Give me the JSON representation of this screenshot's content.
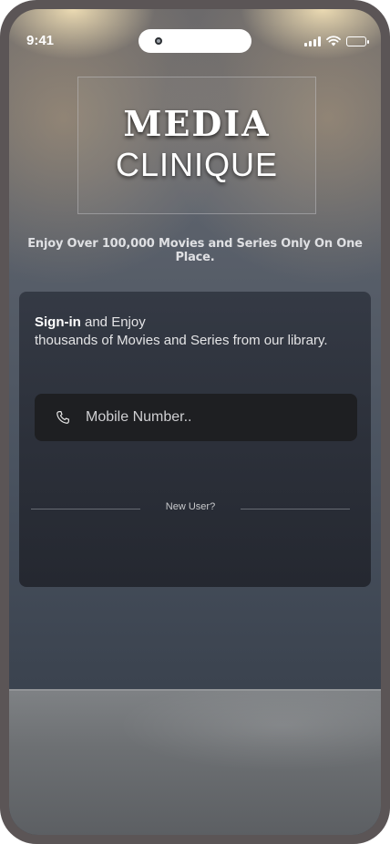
{
  "status_bar": {
    "time": "9:41",
    "icons": [
      "signal-icon",
      "wifi-icon",
      "battery-icon"
    ]
  },
  "brand": {
    "line1": "MEDIA",
    "line2": "CLINIQUE"
  },
  "tagline": "Enjoy Over 100,000 Movies and Series Only On One Place.",
  "signin_card": {
    "intro_bold": "Sign-in",
    "intro_rest": " and Enjoy",
    "intro_line2": "thousands of Movies and Series from our library.",
    "phone_placeholder": "Mobile Number..",
    "phone_icon": "phone-icon",
    "new_user_label": "New User?"
  },
  "colors": {
    "card_bg": "#2b2f38",
    "input_bg": "#1e1f22",
    "text": "#ffffff"
  }
}
